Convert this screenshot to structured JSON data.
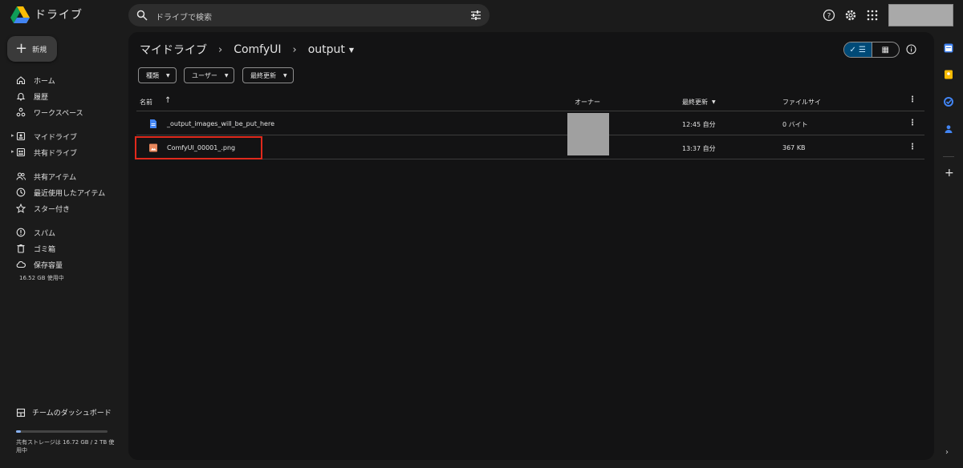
{
  "app": {
    "title": "ドライブ",
    "brand_colors": [
      "#0f9d58",
      "#fbbc04",
      "#4285f4"
    ]
  },
  "search": {
    "placeholder": "ドライブで検索",
    "icon": "search-icon",
    "filter_icon": "tune-icon"
  },
  "header_icons": [
    "help-icon",
    "settings-icon",
    "apps-grid-icon"
  ],
  "new_button": {
    "label": "新規"
  },
  "nav": {
    "items": [
      {
        "label": "ホーム",
        "icon": "home-icon"
      },
      {
        "label": "履歴",
        "icon": "bell-icon"
      },
      {
        "label": "ワークスペース",
        "icon": "workspace-icon"
      },
      {
        "label": "マイドライブ",
        "icon": "my-drive-icon"
      },
      {
        "label": "共有ドライブ",
        "icon": "shared-drive-icon"
      },
      {
        "label": "共有アイテム",
        "icon": "shared-people-icon"
      },
      {
        "label": "最近使用したアイテム",
        "icon": "clock-icon"
      },
      {
        "label": "スター付き",
        "icon": "star-icon"
      },
      {
        "label": "スパム",
        "icon": "spam-icon"
      },
      {
        "label": "ゴミ箱",
        "icon": "trash-icon"
      },
      {
        "label": "保存容量",
        "icon": "cloud-icon"
      }
    ],
    "storage_used": "16.52 GB 使用中",
    "dashboard_label": "チームのダッシュボード",
    "quota_text": "共有ストレージは 16.72 GB / 2 TB 使用中",
    "quota_fraction": 0.008
  },
  "breadcrumb": {
    "items": [
      "マイドライブ",
      "ComfyUI"
    ],
    "current": "output"
  },
  "view": {
    "list_label": "☰",
    "grid_label": "▦",
    "active": "list"
  },
  "filters": [
    {
      "label": "種類"
    },
    {
      "label": "ユーザー"
    },
    {
      "label": "最終更新"
    }
  ],
  "table": {
    "columns": {
      "name": "名前",
      "owner": "オーナー",
      "modified": "最終更新",
      "size": "ファイルサイ"
    },
    "sort": {
      "column": "modified",
      "direction": "desc"
    },
    "rows": [
      {
        "name": "_output_images_will_be_put_here",
        "modified": "12:45 自分",
        "size": "0 バイト",
        "type": "doc",
        "icon": "doc-icon"
      },
      {
        "name": "ComfyUI_00001_.png",
        "modified": "13:37 自分",
        "size": "367 KB",
        "type": "image",
        "icon": "image-icon",
        "highlighted": true
      }
    ]
  },
  "right_rail": [
    "calendar-icon",
    "keep-icon",
    "tasks-icon",
    "contacts-icon",
    "add-icon"
  ]
}
